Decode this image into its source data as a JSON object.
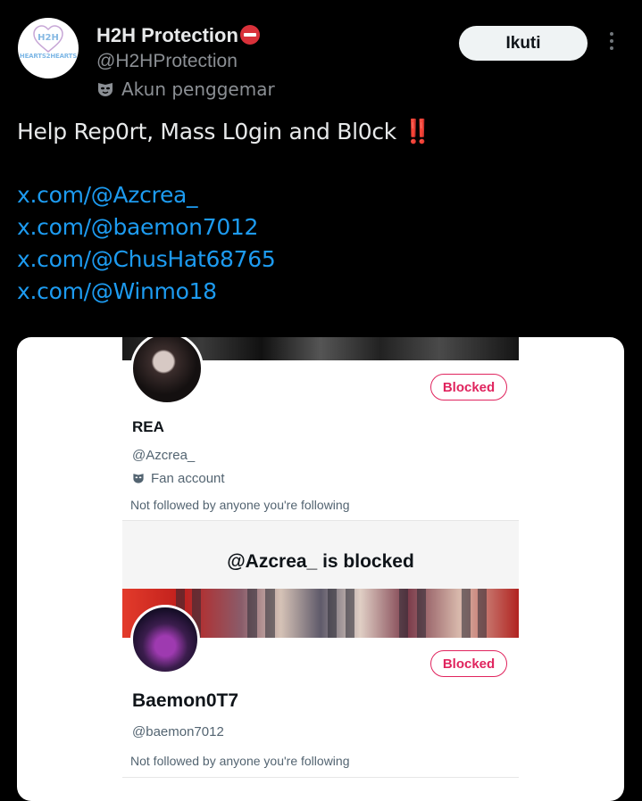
{
  "tweet": {
    "author": {
      "display_name": "H2H Protection",
      "handle": "@H2HProtection",
      "label": "Akun penggemar",
      "avatar_text": "H2H",
      "avatar_brand": "HEARTS2HEARTS"
    },
    "follow_label": "Ikuti",
    "text": "Help Rep0rt, Mass L0gin and Bl0ck",
    "emphasis": "‼️",
    "links": [
      "x.com/@Azcrea_",
      "x.com/@baemon7012",
      "x.com/@ChusHat68765",
      "x.com/@Winmo18"
    ]
  },
  "media": {
    "profiles": [
      {
        "name": "REA",
        "handle": "@Azcrea_",
        "fan_label": "Fan account",
        "not_followed": "Not followed by anyone you're following",
        "blocked_label": "Blocked"
      },
      {
        "name": "Baemon0T7",
        "handle": "@baemon7012",
        "not_followed": "Not followed by anyone you're following",
        "blocked_label": "Blocked"
      }
    ],
    "blocked_message": "@Azcrea_ is blocked"
  },
  "colors": {
    "link": "#1d9bf0",
    "stop_badge": "#d9313a",
    "blocked": "#e0245e",
    "background": "#000000"
  },
  "icons": [
    "stop-icon",
    "mask-icon",
    "more-icon"
  ]
}
